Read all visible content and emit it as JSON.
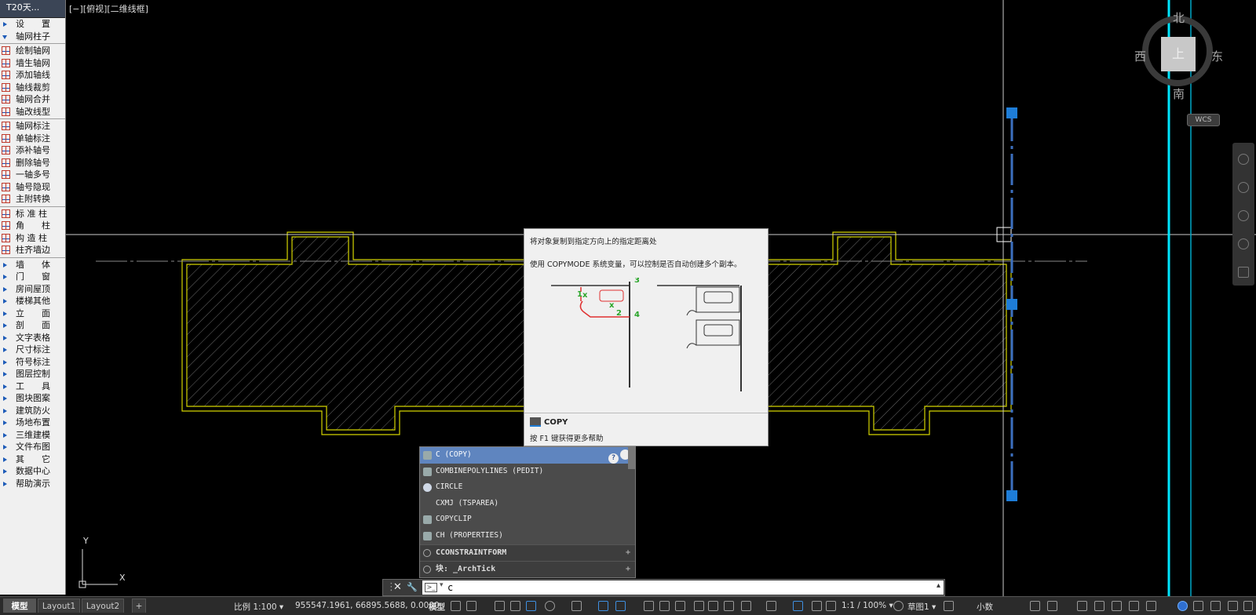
{
  "palette": {
    "title": "T20天...",
    "items": [
      {
        "label": "设　　置",
        "kind": "arrow"
      },
      {
        "label": "轴网柱子",
        "kind": "open"
      },
      {
        "sep": true
      },
      {
        "label": "绘制轴网",
        "kind": "icon"
      },
      {
        "label": "墙生轴网",
        "kind": "icon"
      },
      {
        "label": "添加轴线",
        "kind": "icon"
      },
      {
        "label": "轴线裁剪",
        "kind": "icon"
      },
      {
        "label": "轴网合并",
        "kind": "icon"
      },
      {
        "label": "轴改线型",
        "kind": "icon"
      },
      {
        "sep": true
      },
      {
        "label": "轴网标注",
        "kind": "icon"
      },
      {
        "label": "单轴标注",
        "kind": "icon"
      },
      {
        "label": "添补轴号",
        "kind": "icon"
      },
      {
        "label": "删除轴号",
        "kind": "icon"
      },
      {
        "label": "一轴多号",
        "kind": "icon"
      },
      {
        "label": "轴号隐现",
        "kind": "icon"
      },
      {
        "label": "主附转换",
        "kind": "icon"
      },
      {
        "sep": true
      },
      {
        "label": "标 准 柱",
        "kind": "icon"
      },
      {
        "label": "角　　柱",
        "kind": "icon"
      },
      {
        "label": "构 造 柱",
        "kind": "icon"
      },
      {
        "label": "柱齐墙边",
        "kind": "icon"
      },
      {
        "sep": true
      },
      {
        "label": "墙　　体",
        "kind": "arrow"
      },
      {
        "label": "门　　窗",
        "kind": "arrow"
      },
      {
        "label": "房间屋顶",
        "kind": "arrow"
      },
      {
        "label": "楼梯其他",
        "kind": "arrow"
      },
      {
        "label": "立　　面",
        "kind": "arrow"
      },
      {
        "label": "剖　　面",
        "kind": "arrow"
      },
      {
        "label": "文字表格",
        "kind": "arrow"
      },
      {
        "label": "尺寸标注",
        "kind": "arrow"
      },
      {
        "label": "符号标注",
        "kind": "arrow"
      },
      {
        "label": "图层控制",
        "kind": "arrow"
      },
      {
        "label": "工　　具",
        "kind": "arrow"
      },
      {
        "label": "图块图案",
        "kind": "arrow"
      },
      {
        "label": "建筑防火",
        "kind": "arrow"
      },
      {
        "label": "场地布置",
        "kind": "arrow"
      },
      {
        "label": "三维建模",
        "kind": "arrow"
      },
      {
        "label": "文件布图",
        "kind": "arrow"
      },
      {
        "label": "其　　它",
        "kind": "arrow"
      },
      {
        "label": "数据中心",
        "kind": "arrow"
      },
      {
        "label": "帮助演示",
        "kind": "arrow"
      }
    ]
  },
  "viewport": {
    "label": "[−][俯视][二维线框]"
  },
  "ucs": {
    "x": "X",
    "y": "Y"
  },
  "viewcube": {
    "north": "北",
    "south": "南",
    "east": "东",
    "west": "西",
    "face": "上",
    "wcs": "WCS"
  },
  "tooltip": {
    "line1": "将对象复制到指定方向上的指定距离处",
    "line2": "使用 COPYMODE 系统变量，可以控制是否自动创建多个副本。",
    "steps": [
      "1",
      "2",
      "3",
      "4"
    ],
    "command": "COPY",
    "f1": "按 F1 键获得更多帮助"
  },
  "autocomplete": {
    "items": [
      {
        "label": "C (COPY)",
        "icon": "copy",
        "selected": true
      },
      {
        "label": "COMBINEPOLYLINES (PEDIT)",
        "icon": "pedit"
      },
      {
        "label": "CIRCLE",
        "icon": "circle"
      },
      {
        "label": "CXMJ (TSPAREA)",
        "icon": "none"
      },
      {
        "label": "COPYCLIP",
        "icon": "clip"
      },
      {
        "label": "CH (PROPERTIES)",
        "icon": "props"
      }
    ],
    "categories": [
      {
        "label": "CCONSTRAINTFORM"
      },
      {
        "label": "块: _ArchTick"
      }
    ],
    "help": "?"
  },
  "cmdline": {
    "value": "c",
    "close": "✕",
    "settings": "🔧",
    "recent": "▴"
  },
  "statusbar": {
    "tabs": [
      "模型",
      "Layout1",
      "Layout2",
      "+"
    ],
    "scale": "比例 1:100 ▾",
    "coords": "955547.1961, 66895.5688, 0.0000",
    "space": "模型",
    "annoscale": "1:1 / 100% ▾",
    "workspace": "草图1 ▾",
    "units": "小数"
  },
  "colors": {
    "wall": "#d4d400",
    "cyan": "#00e5ff",
    "grip": "#1e7dd8",
    "selection": "#3c6fbf"
  }
}
